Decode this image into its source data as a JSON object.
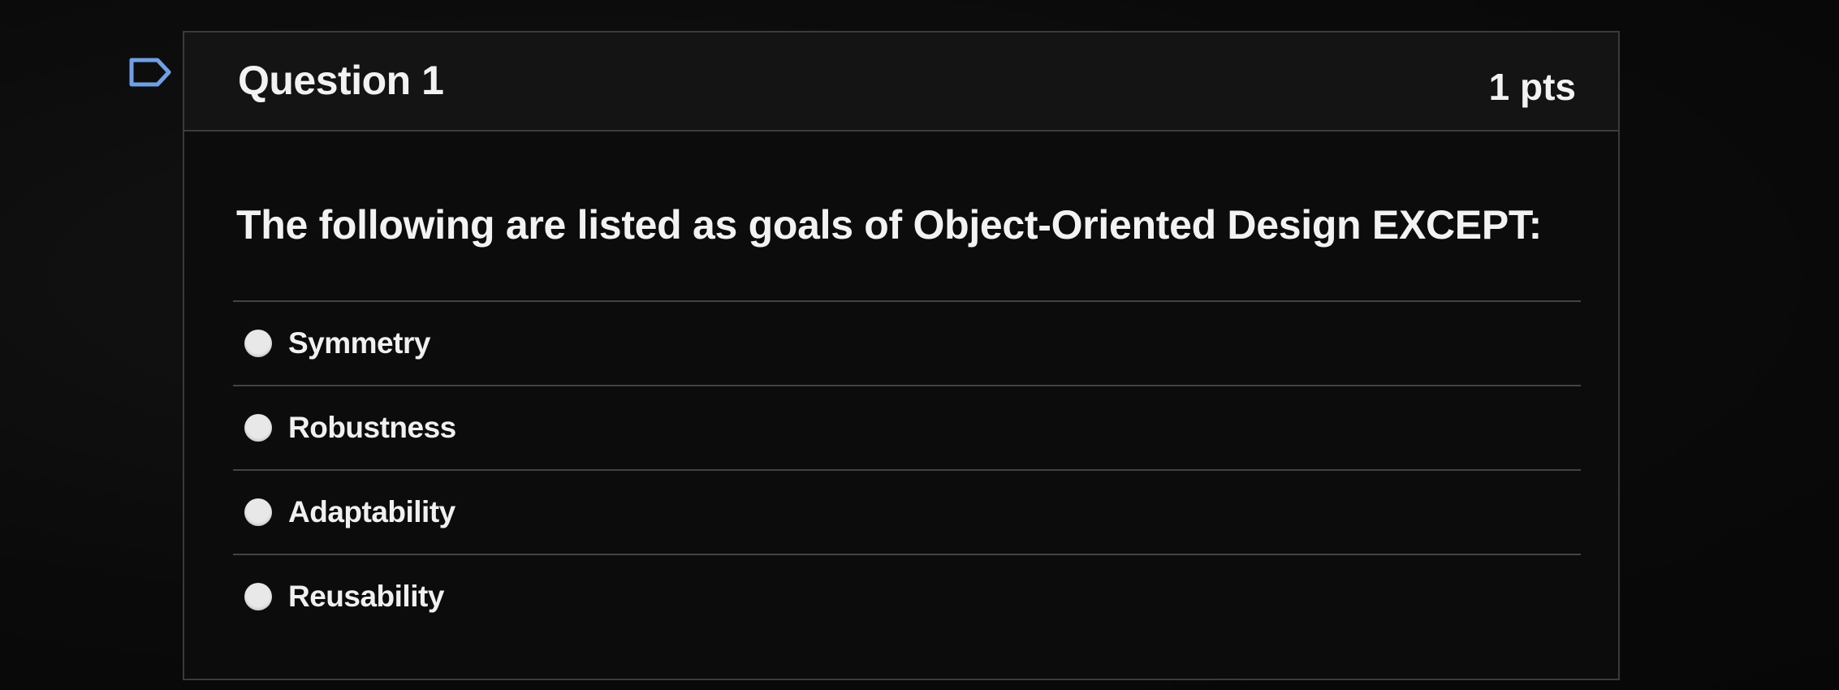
{
  "question": {
    "title": "Question 1",
    "points": "1 pts",
    "text": "The following are listed as goals of Object-Oriented Design EXCEPT:",
    "answers": [
      {
        "label": "Symmetry"
      },
      {
        "label": "Robustness"
      },
      {
        "label": "Adaptability"
      },
      {
        "label": "Reusability"
      }
    ]
  },
  "icons": {
    "flag": "flag-outline-icon",
    "radio": "radio-unselected-icon"
  },
  "colors": {
    "background": "#0b0b0b",
    "card": "#0c0c0c",
    "header": "#141414",
    "text": "#f2f2f2",
    "radio": "#e8e8e8",
    "flag": "#6fa0e6"
  }
}
